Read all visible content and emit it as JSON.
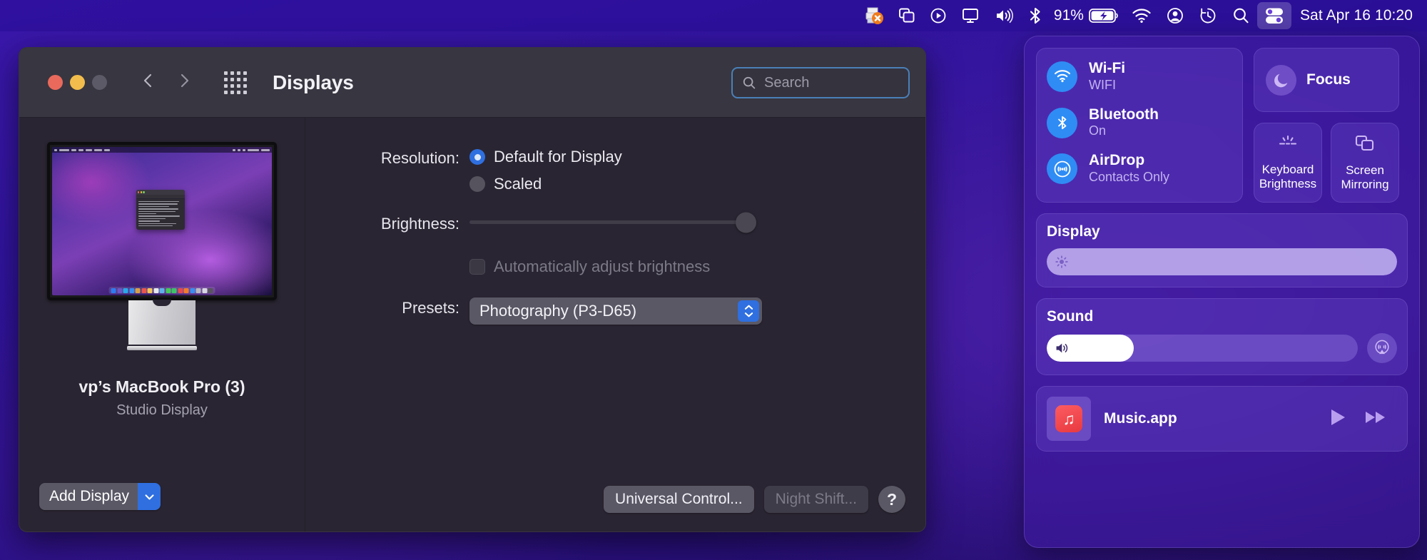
{
  "menubar": {
    "icons": [
      {
        "name": "printer-stopped-icon",
        "label": "Printer"
      },
      {
        "name": "stage-manager-icon",
        "label": "Stage Manager"
      },
      {
        "name": "play-circle-icon",
        "label": "Now Playing"
      },
      {
        "name": "screen-mirroring-icon",
        "label": "Screen Mirroring"
      },
      {
        "name": "volume-icon",
        "label": "Sound"
      },
      {
        "name": "bluetooth-icon",
        "label": "Bluetooth"
      }
    ],
    "battery_percent": "91%",
    "right_icons": [
      {
        "name": "wifi-icon",
        "label": "Wi-Fi"
      },
      {
        "name": "user-account-icon",
        "label": "Account"
      },
      {
        "name": "time-machine-icon",
        "label": "Time Machine"
      },
      {
        "name": "spotlight-search-icon",
        "label": "Spotlight"
      },
      {
        "name": "control-center-icon",
        "label": "Control Center"
      }
    ],
    "clock": "Sat Apr 16  10:20"
  },
  "window": {
    "title": "Displays",
    "search": {
      "placeholder": "Search",
      "value": ""
    },
    "left": {
      "display_name": "vp’s MacBook Pro (3)",
      "display_subtitle": "Studio Display",
      "add_display_label": "Add Display"
    },
    "settings": {
      "resolution_label": "Resolution:",
      "resolution_options": [
        "Default for Display",
        "Scaled"
      ],
      "resolution_selected": "Default for Display",
      "brightness_label": "Brightness:",
      "brightness_value": 100,
      "auto_brightness_label": "Automatically adjust brightness",
      "auto_brightness_checked": false,
      "presets_label": "Presets:",
      "presets_value": "Photography (P3-D65)"
    },
    "buttons": {
      "universal_control": "Universal Control...",
      "night_shift": "Night Shift...",
      "night_shift_disabled": true,
      "help": "?"
    }
  },
  "control_center": {
    "connectivity": [
      {
        "icon": "wifi-icon",
        "title": "Wi-Fi",
        "subtitle": "WIFI"
      },
      {
        "icon": "bluetooth-icon",
        "title": "Bluetooth",
        "subtitle": "On"
      },
      {
        "icon": "airdrop-icon",
        "title": "AirDrop",
        "subtitle": "Contacts Only"
      }
    ],
    "focus": {
      "icon": "moon-icon",
      "label": "Focus"
    },
    "tiles": [
      {
        "icon": "keyboard-brightness-icon",
        "label": "Keyboard\nBrightness",
        "line1": "Keyboard",
        "line2": "Brightness"
      },
      {
        "icon": "screen-mirroring-icon",
        "label": "Screen\nMirroring",
        "line1": "Screen",
        "line2": "Mirroring"
      }
    ],
    "display": {
      "title": "Display",
      "value": 100
    },
    "sound": {
      "title": "Sound",
      "value": 28
    },
    "music": {
      "app_name": "Music.app"
    },
    "accent_blue": "#2f8cf5",
    "panel_purple": "#3f1ba0"
  }
}
